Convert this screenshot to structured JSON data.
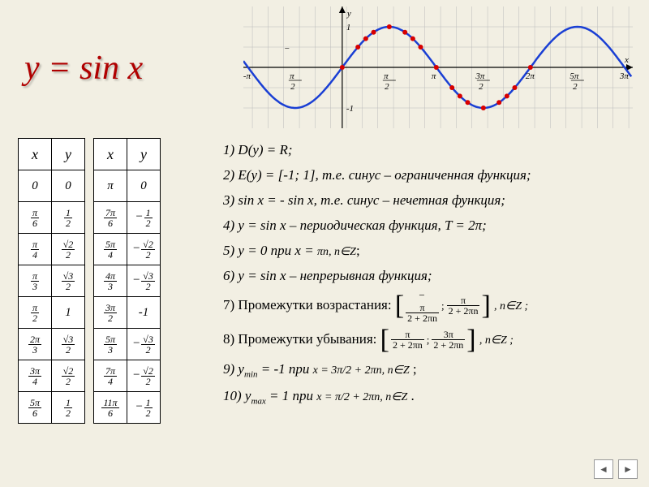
{
  "title": "y = sin x",
  "chart_data": {
    "type": "line",
    "title": "y = sin x",
    "xlabel": "x",
    "ylabel": "y",
    "xlim": [
      -3.3,
      9.7
    ],
    "ylim": [
      -1.5,
      1.5
    ],
    "x_ticks": [
      {
        "v": -3.1416,
        "label": "-π"
      },
      {
        "v": -1.5708,
        "label": "-π/2"
      },
      {
        "v": 1.5708,
        "label": "π/2"
      },
      {
        "v": 3.1416,
        "label": "π"
      },
      {
        "v": 4.7124,
        "label": "3π/2"
      },
      {
        "v": 6.2832,
        "label": "2π"
      },
      {
        "v": 7.854,
        "label": "5π/2"
      },
      {
        "v": 9.4248,
        "label": "3π"
      }
    ],
    "y_ticks": [
      {
        "v": 1,
        "label": "1"
      },
      {
        "v": -1,
        "label": "-1"
      }
    ],
    "series": [
      {
        "name": "sin x",
        "fn": "sin",
        "x_range": [
          -3.3,
          9.7
        ]
      }
    ],
    "highlight_points": [
      {
        "x": 0,
        "y": 0
      },
      {
        "x": 0.5236,
        "y": 0.5
      },
      {
        "x": 0.7854,
        "y": 0.7071
      },
      {
        "x": 1.0472,
        "y": 0.866
      },
      {
        "x": 1.5708,
        "y": 1
      },
      {
        "x": 2.0944,
        "y": 0.866
      },
      {
        "x": 2.3562,
        "y": 0.7071
      },
      {
        "x": 2.618,
        "y": 0.5
      },
      {
        "x": 3.1416,
        "y": 0
      },
      {
        "x": 3.6652,
        "y": -0.5
      },
      {
        "x": 3.927,
        "y": -0.7071
      },
      {
        "x": 4.1888,
        "y": -0.866
      },
      {
        "x": 4.7124,
        "y": -1
      },
      {
        "x": 5.236,
        "y": -0.866
      },
      {
        "x": 5.4978,
        "y": -0.7071
      },
      {
        "x": 5.7596,
        "y": -0.5
      },
      {
        "x": 6.2832,
        "y": 0
      }
    ]
  },
  "table1": {
    "head": [
      "x",
      "y"
    ],
    "rows": [
      [
        "0",
        "0"
      ],
      [
        "π/6",
        "1/2"
      ],
      [
        "π/4",
        "√2/2"
      ],
      [
        "π/3",
        "√3/2"
      ],
      [
        "π/2",
        "1"
      ],
      [
        "2π/3",
        "√3/2"
      ],
      [
        "3π/4",
        "√2/2"
      ],
      [
        "5π/6",
        "1/2"
      ]
    ]
  },
  "table2": {
    "head": [
      "x",
      "y"
    ],
    "rows": [
      [
        "π",
        "0"
      ],
      [
        "7π/6",
        "-1/2"
      ],
      [
        "5π/4",
        "-√2/2"
      ],
      [
        "4π/3",
        "-√3/2"
      ],
      [
        "3π/2",
        "-1"
      ],
      [
        "5π/3",
        "-√3/2"
      ],
      [
        "7π/4",
        "-√2/2"
      ],
      [
        "11π/6",
        "-1/2"
      ]
    ]
  },
  "props": {
    "p1": "1) D(y) = R;",
    "p2": "2) E(y) = [-1; 1], т.е. синус – ограниченная функция;",
    "p3": "3) sin x = - sin x, т.е. синус – нечетная функция;",
    "p4": "4) y = sin x – периодическая функция, T = 2π;",
    "p5a": "5) y = 0 при x = ",
    "p5b": "πn, n∈Z",
    "p5c": ";",
    "p6": "6) y = sin x – непрерывная функция;",
    "p7a": "7) Промежутки возрастания:",
    "p7b": ", n∈Z ;",
    "p8a": "8) Промежутки убывания:",
    "p8b": ", n∈Z ;",
    "p9a": "9) y",
    "p9sub": "min",
    "p9b": "= -1 при ",
    "p9c": " ;",
    "p10a": "10) y",
    "p10sub": "max",
    "p10b": " = 1 при ",
    "p10c": " .",
    "interval7": [
      "-π/2 + 2πn",
      "π/2 + 2πn"
    ],
    "interval8": [
      "π/2 + 2πn",
      "3π/2 + 2πn"
    ],
    "cond9": "x = 3π/2 + 2πn, n∈Z",
    "cond10": "x = π/2 + 2πn, n∈Z"
  },
  "nav": {
    "back": "◄",
    "fwd": "►"
  }
}
